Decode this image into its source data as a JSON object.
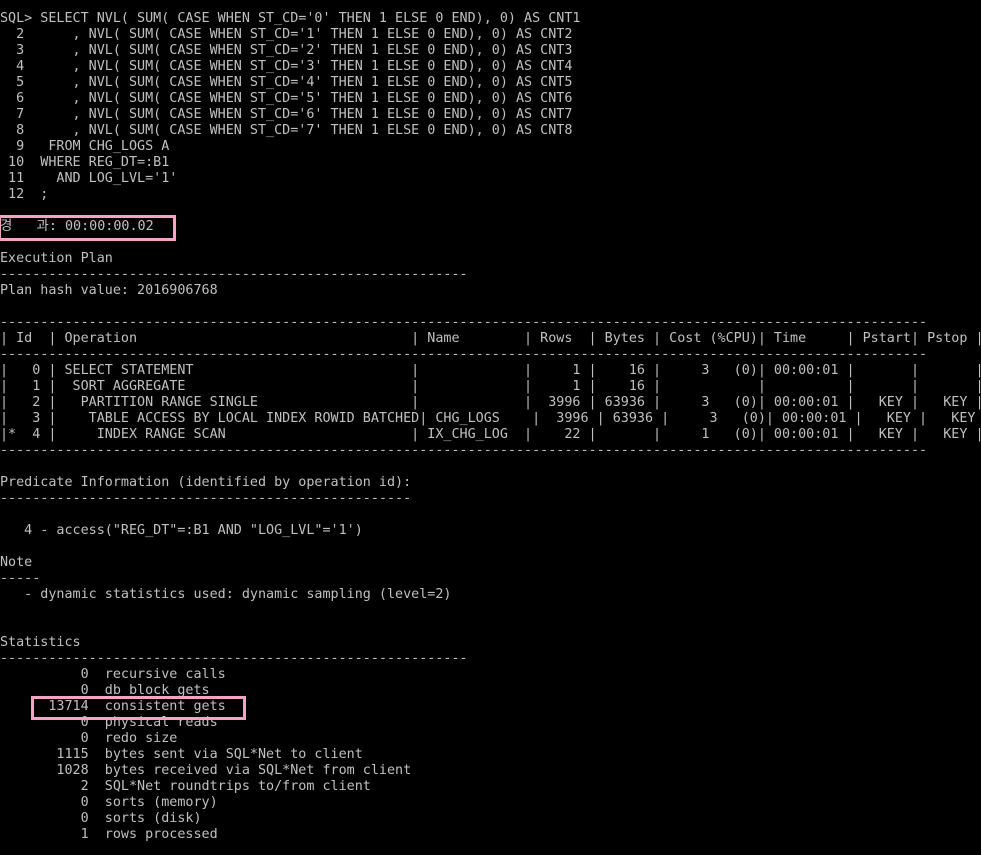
{
  "query": [
    "SQL> SELECT NVL( SUM( CASE WHEN ST_CD='0' THEN 1 ELSE 0 END), 0) AS CNT1",
    "  2      , NVL( SUM( CASE WHEN ST_CD='1' THEN 1 ELSE 0 END), 0) AS CNT2",
    "  3      , NVL( SUM( CASE WHEN ST_CD='2' THEN 1 ELSE 0 END), 0) AS CNT3",
    "  4      , NVL( SUM( CASE WHEN ST_CD='3' THEN 1 ELSE 0 END), 0) AS CNT4",
    "  5      , NVL( SUM( CASE WHEN ST_CD='4' THEN 1 ELSE 0 END), 0) AS CNT5",
    "  6      , NVL( SUM( CASE WHEN ST_CD='5' THEN 1 ELSE 0 END), 0) AS CNT6",
    "  7      , NVL( SUM( CASE WHEN ST_CD='6' THEN 1 ELSE 0 END), 0) AS CNT7",
    "  8      , NVL( SUM( CASE WHEN ST_CD='7' THEN 1 ELSE 0 END), 0) AS CNT8",
    "  9   FROM CHG_LOGS A",
    " 10  WHERE REG_DT=:B1",
    " 11    AND LOG_LVL='1'",
    " 12  ;"
  ],
  "elapsed": "경   과: 00:00:00.02",
  "plan_title": "Execution Plan",
  "plan_rule": "----------------------------------------------------------",
  "plan_hash": "Plan hash value: 2016906768",
  "table_rule": "-------------------------------------------------------------------------------------------------------------------",
  "table_header": "| Id  | Operation                                  | Name        | Rows  | Bytes | Cost (%CPU)| Time     | Pstart| Pstop |",
  "table_rows": [
    "|   0 | SELECT STATEMENT                           |             |     1 |    16 |     3   (0)| 00:00:01 |       |       |",
    "|   1 |  SORT AGGREGATE                            |             |     1 |    16 |            |          |       |       |",
    "|   2 |   PARTITION RANGE SINGLE                   |             |  3996 | 63936 |     3   (0)| 00:00:01 |   KEY |   KEY |",
    "|   3 |    TABLE ACCESS BY LOCAL INDEX ROWID BATCHED| CHG_LOGS    |  3996 | 63936 |     3   (0)| 00:00:01 |   KEY |   KEY |",
    "|*  4 |     INDEX RANGE SCAN                       | IX_CHG_LOG  |    22 |       |     1   (0)| 00:00:01 |   KEY |   KEY |"
  ],
  "predicate_title": "Predicate Information (identified by operation id):",
  "predicate_rule": "---------------------------------------------------",
  "predicate_line": "   4 - access(\"REG_DT\"=:B1 AND \"LOG_LVL\"='1')",
  "note_title": "Note",
  "note_rule": "-----",
  "note_line": "   - dynamic statistics used: dynamic sampling (level=2)",
  "stats_title": "Statistics",
  "stats_rule": "----------------------------------------------------------",
  "stats": [
    "          0  recursive calls",
    "          0  db block gets",
    "      13714  consistent gets",
    "          0  physical reads",
    "          0  redo size",
    "       1115  bytes sent via SQL*Net to client",
    "       1028  bytes received via SQL*Net from client",
    "          2  SQL*Net roundtrips to/from client",
    "          0  sorts (memory)",
    "          0  sorts (disk)",
    "          1  rows processed"
  ],
  "colors": {
    "background": "#000000",
    "text": "#c0c0c0",
    "highlight": "#f4a3c4"
  }
}
